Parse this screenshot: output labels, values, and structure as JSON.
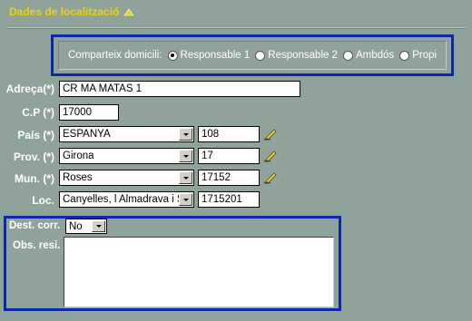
{
  "section": {
    "title": "Dades de localització",
    "collapse_icon": "triangle-up-icon"
  },
  "domicile": {
    "label": "Comparteix domicili:",
    "options": [
      {
        "label": "Responsable 1",
        "selected": true
      },
      {
        "label": "Responsable 2",
        "selected": false
      },
      {
        "label": "Ambdós",
        "selected": false
      },
      {
        "label": "Propi",
        "selected": false
      }
    ]
  },
  "address": {
    "label": "Adreça(*)",
    "value": "CR MA MATAS 1"
  },
  "postal_code": {
    "label": "C.P (*)",
    "value": "17000"
  },
  "country": {
    "label": "País (*)",
    "selected": "ESPANYA",
    "code": "108",
    "edit_icon": "pencil-icon"
  },
  "province": {
    "label": "Prov. (*)",
    "selected": "Girona",
    "code": "17",
    "edit_icon": "pencil-icon"
  },
  "municipality": {
    "label": "Mun. (*)",
    "selected": "Roses",
    "code": "17152",
    "edit_icon": "pencil-icon"
  },
  "locality": {
    "label": "Loc.",
    "selected": "Canyelles, l Almadrava i Sant",
    "code": "1715201"
  },
  "mailing": {
    "dest_label": "Dest. corr.",
    "dest_selected": "No",
    "obs_label": "Obs. resi.",
    "obs_value": ""
  },
  "colors": {
    "background": "#8fa39b",
    "title": "#f1d200",
    "highlight_border": "#0c2aa8"
  }
}
